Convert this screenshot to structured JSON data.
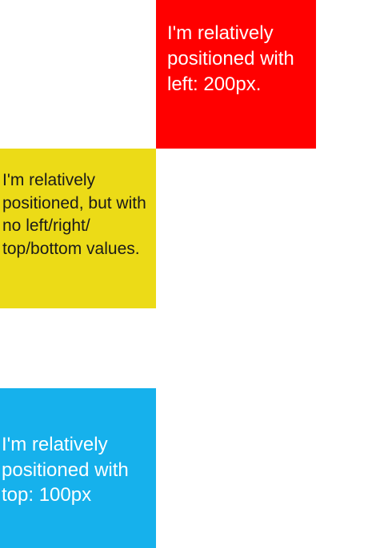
{
  "boxes": {
    "red": {
      "text": "I'm relatively positioned with left: 200px.",
      "background": "#ff0000",
      "text_color": "#ffffff"
    },
    "yellow": {
      "text": "I'm relatively positioned, but with no left/right/ top/bottom values.",
      "background": "#ecdb17",
      "text_color": "#1a1a1a"
    },
    "blue": {
      "text": "I'm relatively positioned with top: 100px",
      "background": "#16b1ec",
      "text_color": "#ffffff"
    }
  }
}
